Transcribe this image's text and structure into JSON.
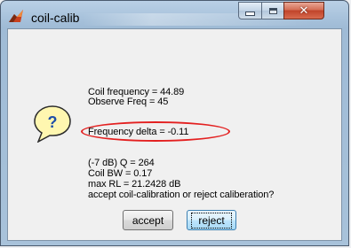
{
  "window": {
    "title": "coil-calib"
  },
  "titlebar_buttons": {
    "minimize": "minimize",
    "maximize": "maximize",
    "close": "close"
  },
  "dialog": {
    "icon": "question-icon",
    "icon_glyph": "?",
    "lines": [
      "Coil frequency = 44.89",
      "Observe Freq = 45",
      "Frequency delta = -0.11",
      "(-7 dB) Q = 264",
      "Coil BW = 0.17",
      "max RL = 21.2428 dB",
      "accept coil-calibration  or reject caliberation?"
    ],
    "highlight_color": "#e32020"
  },
  "buttons": {
    "accept": "accept",
    "reject": "reject"
  }
}
